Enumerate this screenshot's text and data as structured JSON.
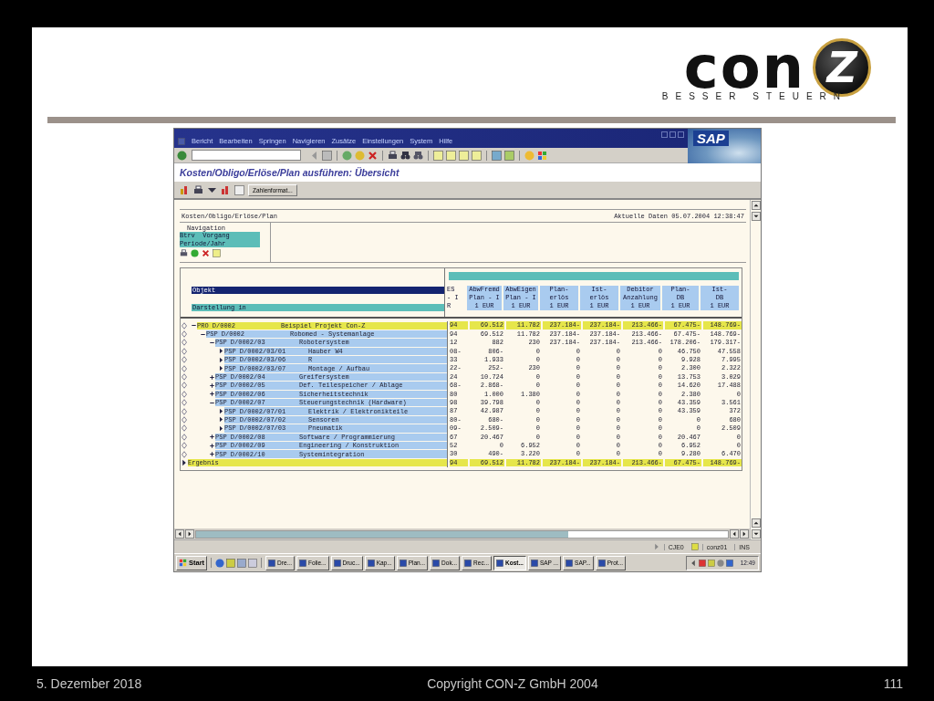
{
  "slide": {
    "logo": {
      "wordmark": "con",
      "emblem": "Z",
      "tagline": "BESSER STEUERN"
    }
  },
  "sap": {
    "menu": [
      "Bericht",
      "Bearbeiten",
      "Springen",
      "Navigieren",
      "Zusätze",
      "Einstellungen",
      "System",
      "Hilfe"
    ],
    "logo": "SAP",
    "title": "Kosten/Obligo/Erlöse/Plan ausführen: Übersicht",
    "app_toolbar": {
      "button": "Zahlenformat..."
    },
    "report": {
      "heading": "Kosten/Obligo/Erlöse/Plan",
      "timestamp": "Aktuelle Daten 05.07.2004 12:38:47",
      "navigation": {
        "title": "Navigation",
        "items": [
          "Btrv  Vorgang",
          "Periode/Jahr"
        ]
      },
      "object_label": "Objekt",
      "display_label": "Darstellung in",
      "columns": [
        [
          "ES",
          "- I",
          "R"
        ],
        [
          "AbwFremd",
          "Plan - I",
          "1 EUR"
        ],
        [
          "AbwEigen",
          "Plan - I",
          "1 EUR"
        ],
        [
          "Plan-",
          "erlös",
          "1 EUR"
        ],
        [
          "Ist-",
          "erlös",
          "1 EUR"
        ],
        [
          "Debitor",
          "Anzahlung",
          "1 EUR"
        ],
        [
          "Plan-",
          "DB",
          "1 EUR"
        ],
        [
          "Ist-",
          "DB",
          "1 EUR"
        ]
      ],
      "rows": [
        {
          "kind": "total",
          "id": "PRO D/0002",
          "text": "Beispiel Projekt Con-Z",
          "values": [
            "94",
            "69.512",
            "11.782",
            "237.184-",
            "237.184-",
            "213.466-",
            "67.475-",
            "148.769-"
          ],
          "expanded": true,
          "children": [
            {
              "kind": "item",
              "id": "PSP D/0002",
              "text": "Robomed - Systemanlage",
              "values": [
                "94",
                "69.512",
                "11.782",
                "237.184-",
                "237.184-",
                "213.466-",
                "67.475-",
                "148.769-"
              ],
              "expanded": true,
              "children": [
                {
                  "kind": "item",
                  "id": "PSP D/0002/03",
                  "text": "Robotersystem",
                  "values": [
                    "12",
                    "882",
                    "230",
                    "237.184-",
                    "237.184-",
                    "213.466-",
                    "178.206-",
                    "179.317-"
                  ],
                  "expanded": true,
                  "children": [
                    {
                      "kind": "item",
                      "id": "PSP D/0002/03/01",
                      "text": "Hauber W4",
                      "values": [
                        "08-",
                        "806-",
                        "0",
                        "0",
                        "0",
                        "0",
                        "46.750",
                        "47.558"
                      ]
                    },
                    {
                      "kind": "item",
                      "id": "PSP D/0002/03/06",
                      "text": "R",
                      "values": [
                        "33",
                        "1.933",
                        "0",
                        "0",
                        "0",
                        "0",
                        "9.928",
                        "7.995"
                      ]
                    },
                    {
                      "kind": "item",
                      "id": "PSP D/0002/03/07",
                      "text": "Montage / Aufbau",
                      "values": [
                        "22-",
                        "252-",
                        "230",
                        "0",
                        "0",
                        "0",
                        "2.300",
                        "2.322"
                      ]
                    }
                  ]
                },
                {
                  "kind": "item",
                  "id": "PSP D/0002/04",
                  "text": "Greifersystem",
                  "values": [
                    "24",
                    "10.724",
                    "0",
                    "0",
                    "0",
                    "0",
                    "13.753",
                    "3.029"
                  ],
                  "expanded": false
                },
                {
                  "kind": "item",
                  "id": "PSP D/0002/05",
                  "text": "Def. Teilespeicher / Ablage",
                  "values": [
                    "68-",
                    "2.868-",
                    "0",
                    "0",
                    "0",
                    "0",
                    "14.620",
                    "17.488"
                  ],
                  "expanded": false
                },
                {
                  "kind": "item",
                  "id": "PSP D/0002/06",
                  "text": "Sicherheitstechnik",
                  "values": [
                    "80",
                    "1.000",
                    "1.380",
                    "0",
                    "0",
                    "0",
                    "2.380",
                    "0"
                  ],
                  "expanded": false
                },
                {
                  "kind": "item",
                  "id": "PSP D/0002/07",
                  "text": "Steuerungstechnik (Hardware)",
                  "values": [
                    "98",
                    "39.798",
                    "0",
                    "0",
                    "0",
                    "0",
                    "43.359",
                    "3.561"
                  ],
                  "expanded": true,
                  "children": [
                    {
                      "kind": "item",
                      "id": "PSP D/0002/07/01",
                      "text": "Elektrik / Elektronikteile",
                      "values": [
                        "87",
                        "42.987",
                        "0",
                        "0",
                        "0",
                        "0",
                        "43.359",
                        "372"
                      ]
                    },
                    {
                      "kind": "item",
                      "id": "PSP D/0002/07/02",
                      "text": "Sensoren",
                      "values": [
                        "80-",
                        "680-",
                        "0",
                        "0",
                        "0",
                        "0",
                        "0",
                        "680"
                      ]
                    },
                    {
                      "kind": "item",
                      "id": "PSP D/0002/07/03",
                      "text": "Pneumatik",
                      "values": [
                        "09-",
                        "2.509-",
                        "0",
                        "0",
                        "0",
                        "0",
                        "0",
                        "2.509"
                      ]
                    }
                  ]
                },
                {
                  "kind": "item",
                  "id": "PSP D/0002/08",
                  "text": "Software / Programmierung",
                  "values": [
                    "67",
                    "20.467",
                    "0",
                    "0",
                    "0",
                    "0",
                    "20.467",
                    "0"
                  ],
                  "expanded": false
                },
                {
                  "kind": "item",
                  "id": "PSP D/0002/09",
                  "text": "Engineering / Konstruktion",
                  "values": [
                    "52",
                    "0",
                    "6.952",
                    "0",
                    "0",
                    "0",
                    "6.952",
                    "0"
                  ],
                  "expanded": false
                },
                {
                  "kind": "item",
                  "id": "PSP D/0002/10",
                  "text": "Systemintegration",
                  "values": [
                    "30",
                    "490-",
                    "3.220",
                    "0",
                    "0",
                    "0",
                    "9.280",
                    "6.470"
                  ],
                  "expanded": false
                }
              ]
            }
          ]
        }
      ],
      "result": {
        "label": "Ergebnis",
        "values": [
          "94",
          "69.512",
          "11.782",
          "237.184-",
          "237.184-",
          "213.466-",
          "67.475-",
          "148.769-"
        ]
      }
    },
    "status_bar": {
      "transaction": "CJE0",
      "user": "conz01",
      "mode": "INS"
    },
    "taskbar": {
      "start": "Start",
      "tasks": [
        {
          "label": "Dre...",
          "selected": false
        },
        {
          "label": "Folie...",
          "selected": false
        },
        {
          "label": "Druc...",
          "selected": false
        },
        {
          "label": "Kap...",
          "selected": false
        },
        {
          "label": "Plan...",
          "selected": false
        },
        {
          "label": "Dok...",
          "selected": false
        },
        {
          "label": "Rec...",
          "selected": false
        },
        {
          "label": "Kost...",
          "selected": true
        },
        {
          "label": "SAP ...",
          "selected": false
        },
        {
          "label": "SAP...",
          "selected": false
        },
        {
          "label": "Prot...",
          "selected": false
        }
      ],
      "clock": "12:49"
    }
  },
  "footer": {
    "date": "5. Dezember 2018",
    "copyright": "Copyright CON-Z GmbH 2004",
    "page": "111"
  }
}
